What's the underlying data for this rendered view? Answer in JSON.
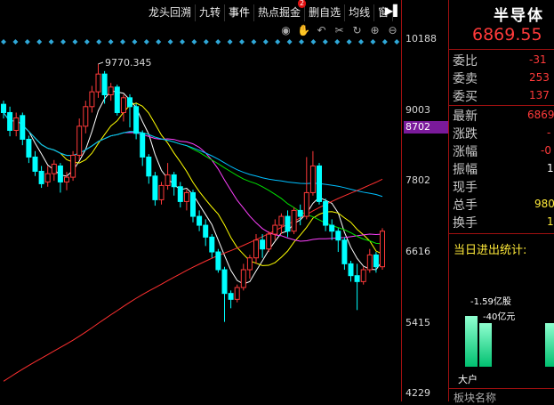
{
  "tabs": [
    {
      "label": "龙头回溯",
      "selected": false
    },
    {
      "label": "九转",
      "selected": false
    },
    {
      "label": "事件",
      "selected": true
    },
    {
      "label": "热点掘金",
      "selected": false,
      "badge": "2"
    },
    {
      "label": "删自选",
      "selected": false
    },
    {
      "label": "均线",
      "selected": false
    },
    {
      "label": "窗",
      "selected": false
    }
  ],
  "tab_more_icon": "▶▌",
  "toolbar_icons": [
    "eye-icon",
    "hand-icon",
    "undo-icon",
    "scissors-icon",
    "refresh-icon",
    "zoom-in-icon",
    "zoom-out-icon"
  ],
  "axis": {
    "labels": [
      "10188",
      "9003",
      "7802",
      "6616",
      "5415",
      "4229"
    ],
    "highlight": "8702",
    "highlight_color": "#7a1a9a"
  },
  "peak_label": "9770.345",
  "panel": {
    "title": "半导体",
    "price": "6869.55",
    "rows": [
      {
        "label": "委比",
        "value": "-31"
      },
      {
        "label": "委卖",
        "value": "253"
      },
      {
        "label": "委买",
        "value": "137"
      },
      {
        "label": "最新",
        "value": "6869"
      },
      {
        "label": "涨跌",
        "value": "-"
      },
      {
        "label": "涨幅",
        "value": "-0"
      },
      {
        "label": "振幅",
        "value": "1"
      },
      {
        "label": "现手",
        "value": ""
      },
      {
        "label": "总手",
        "value": "980"
      },
      {
        "label": "换手",
        "value": "1"
      }
    ],
    "stats_title": "当日进出统计:",
    "flow_label_1": "-1.59亿股",
    "flow_label_2": "-40亿元",
    "bar_label": "大户",
    "bottom_label": "板块名称"
  },
  "colors": {
    "up": "#ff3a3a",
    "down": "#00ffff",
    "ma5": "#ffffff",
    "ma10": "#ffff00",
    "ma20": "#ff40ff",
    "ma30": "#00e000",
    "ma60": "#00bfff",
    "ma120": "#ff3030"
  },
  "chart_data": {
    "type": "candlestick",
    "ylim": [
      4229,
      10188
    ],
    "candles": [
      [
        9090,
        8950,
        9150,
        8850
      ],
      [
        8950,
        8650,
        9050,
        8550
      ],
      [
        8650,
        8860,
        8950,
        8550
      ],
      [
        8900,
        8500,
        8950,
        8400
      ],
      [
        8500,
        8200,
        8560,
        8100
      ],
      [
        8200,
        7960,
        8300,
        7880
      ],
      [
        7960,
        7750,
        8050,
        7680
      ],
      [
        7780,
        7920,
        8050,
        7700
      ],
      [
        7920,
        8080,
        8150,
        7800
      ],
      [
        8050,
        7780,
        8100,
        7600
      ],
      [
        7780,
        7860,
        7950,
        7640
      ],
      [
        7860,
        8230,
        8300,
        7800
      ],
      [
        8230,
        8720,
        8850,
        8150
      ],
      [
        8720,
        9050,
        9150,
        8600
      ],
      [
        9050,
        9300,
        9400,
        8950
      ],
      [
        9300,
        9600,
        9770,
        9200
      ],
      [
        9600,
        9250,
        9650,
        9100
      ],
      [
        9250,
        9380,
        9450,
        9150
      ],
      [
        9380,
        8950,
        9420,
        8900
      ],
      [
        8950,
        9200,
        9250,
        8800
      ],
      [
        9200,
        9050,
        9260,
        8700
      ],
      [
        9050,
        8600,
        9100,
        8500
      ],
      [
        8600,
        8200,
        8650,
        8050
      ],
      [
        8200,
        7880,
        8250,
        7750
      ],
      [
        7880,
        7480,
        7950,
        7380
      ],
      [
        7480,
        7720,
        7780,
        7400
      ],
      [
        7720,
        7900,
        8100,
        7650
      ],
      [
        7900,
        7700,
        7950,
        7550
      ],
      [
        7700,
        7450,
        7780,
        7350
      ],
      [
        7450,
        7600,
        7650,
        7300
      ],
      [
        7600,
        7200,
        7650,
        7100
      ],
      [
        7200,
        7050,
        7300,
        6950
      ],
      [
        7050,
        6850,
        7150,
        6700
      ],
      [
        6850,
        6600,
        6900,
        6500
      ],
      [
        6600,
        6300,
        6650,
        6250
      ],
      [
        6300,
        5900,
        6350,
        5420
      ],
      [
        5900,
        5800,
        5950,
        5650
      ],
      [
        5800,
        6000,
        6050,
        5750
      ],
      [
        6000,
        6300,
        6400,
        5950
      ],
      [
        6300,
        6500,
        6550,
        6150
      ],
      [
        6500,
        6800,
        6900,
        6400
      ],
      [
        6800,
        6650,
        6900,
        6500
      ],
      [
        6650,
        6900,
        6950,
        6600
      ],
      [
        6900,
        7050,
        7150,
        6800
      ],
      [
        7050,
        7200,
        7250,
        6900
      ],
      [
        7200,
        6950,
        7300,
        6850
      ],
      [
        6950,
        7300,
        7350,
        6900
      ],
      [
        7300,
        7200,
        7400,
        7050
      ],
      [
        7200,
        7600,
        8200,
        7150
      ],
      [
        7600,
        8050,
        8300,
        7550
      ],
      [
        8050,
        7450,
        8100,
        7400
      ],
      [
        7450,
        7050,
        7500,
        6950
      ],
      [
        7050,
        6950,
        7150,
        6800
      ],
      [
        6950,
        6800,
        7000,
        6600
      ],
      [
        6800,
        6400,
        6850,
        6300
      ],
      [
        6400,
        6200,
        6450,
        6100
      ],
      [
        6200,
        6100,
        6400,
        5620
      ],
      [
        6100,
        6300,
        6350,
        6050
      ],
      [
        6300,
        6550,
        6650,
        6250
      ],
      [
        6550,
        6350,
        6600,
        6250
      ],
      [
        6350,
        6950,
        7000,
        6300
      ]
    ]
  }
}
